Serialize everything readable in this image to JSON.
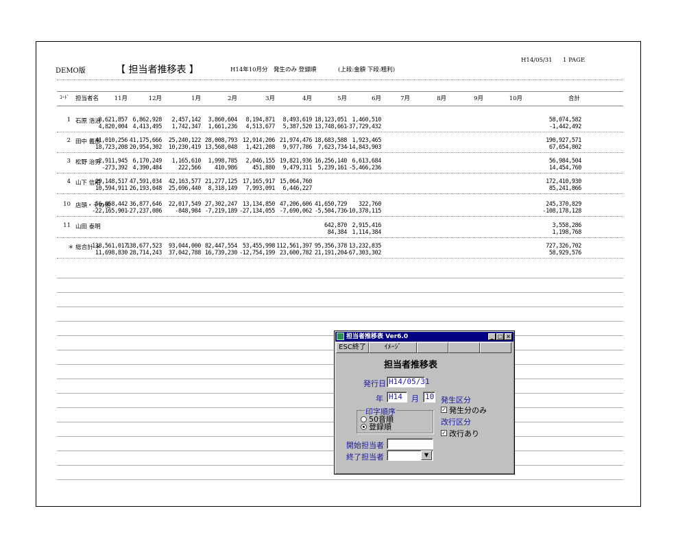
{
  "report": {
    "label": "DEMO版",
    "title": "【 担当者推移表 】",
    "condition": "H14年10月分　発生のみ 登録順",
    "legend": "(上段:金額 下段:粗利)",
    "date": "H14/05/31",
    "page": "1 PAGE"
  },
  "columns": {
    "code": "ｺｰﾄﾞ",
    "name": "担当者名",
    "months": [
      "11月",
      "12月",
      "1月",
      "2月",
      "3月",
      "4月",
      "5月",
      "6月",
      "7月",
      "8月",
      "9月",
      "10月"
    ],
    "total": "合計"
  },
  "rows": [
    {
      "code": "1",
      "name": "石原 浩治",
      "amount": [
        "8,621,857",
        "6,862,928",
        "2,457,142",
        "3,860,604",
        "8,194,871",
        "8,493,619",
        "18,123,051",
        "1,460,510"
      ],
      "amount_total": "58,074,582",
      "profit": [
        "4,820,004",
        "4,413,495",
        "1,742,347",
        "1,661,236",
        "4,513,677",
        "5,387,520",
        "13,748,661",
        "-37,729,432"
      ],
      "profit_total": "-1,442,492"
    },
    {
      "code": "2",
      "name": "田中 義彦",
      "amount": [
        "41,010,256",
        "41,175,666",
        "25,240,122",
        "28,008,793",
        "12,914,206",
        "21,974,476",
        "18,683,588",
        "1,923,465"
      ],
      "amount_total": "190,927,571",
      "profit": [
        "18,723,208",
        "20,954,302",
        "10,230,419",
        "13,568,048",
        "1,421,208",
        "9,977,786",
        "7,623,734",
        "-14,843,903"
      ],
      "profit_total": "67,654,802"
    },
    {
      "code": "3",
      "name": "松野 治男",
      "amount": [
        "2,911,945",
        "6,170,249",
        "1,165,610",
        "1,998,785",
        "2,046,155",
        "19,821,936",
        "16,256,140",
        "6,613,684"
      ],
      "amount_total": "56,984,504",
      "profit": [
        "-273,392",
        "4,390,484",
        "222,566",
        "410,986",
        "451,880",
        "9,479,311",
        "5,239,161",
        "-5,466,236"
      ],
      "profit_total": "14,454,760"
    },
    {
      "code": "4",
      "name": "山下 信昭",
      "amount": [
        "29,148,517",
        "47,591,034",
        "42,163,577",
        "21,277,125",
        "17,165,917",
        "15,064,760",
        "",
        ""
      ],
      "amount_total": "172,410,930",
      "profit": [
        "10,594,911",
        "26,193,048",
        "25,696,440",
        "8,318,149",
        "7,993,091",
        "6,446,227",
        "",
        ""
      ],
      "profit_total": "85,241,866"
    },
    {
      "code": "10",
      "name": "店頭・その他",
      "amount": [
        "56,858,442",
        "36,877,646",
        "22,017,549",
        "27,302,247",
        "13,134,850",
        "47,206,606",
        "41,650,729",
        "322,760"
      ],
      "amount_total": "245,370,829",
      "profit": [
        "-22,165,901",
        "-27,237,086",
        "-848,984",
        "-7,219,189",
        "-27,134,055",
        "-7,690,062",
        "-5,504,736",
        "-10,378,115"
      ],
      "profit_total": "-108,178,128"
    },
    {
      "code": "11",
      "name": "山田 泰明",
      "amount": [
        "",
        "",
        "",
        "",
        "",
        "",
        "642,870",
        "2,915,416"
      ],
      "amount_total": "3,558,286",
      "profit": [
        "",
        "",
        "",
        "",
        "",
        "",
        "84,384",
        "1,114,384"
      ],
      "profit_total": "1,198,768"
    },
    {
      "code": "",
      "name": "＊ 総合計 ＊",
      "amount": [
        "138,561,017",
        "138,677,523",
        "93,044,000",
        "82,447,554",
        "53,455,998",
        "112,561,397",
        "95,356,378",
        "13,232,835"
      ],
      "amount_total": "727,326,702",
      "profit": [
        "11,698,830",
        "28,714,243",
        "37,042,788",
        "16,739,230",
        "-12,754,199",
        "23,600,782",
        "21,191,204",
        "-67,303,302"
      ],
      "profit_total": "58,929,576"
    }
  ],
  "dialog": {
    "window_title": "担当者推移表 Ver6.0",
    "esc_button": "ESC終了",
    "image_button": "ｲﾒｰｼﾞ",
    "heading": "担当者推移表",
    "issue_date_label": "発行日",
    "issue_date_value": "H14/05/31",
    "year_label": "年",
    "year_value": "H14",
    "month_label": "月",
    "month_value": "10",
    "print_order_label": "印字順序",
    "order_option_1": "50音順",
    "order_option_2": "登録順",
    "occur_label": "発生区分",
    "occur_option": "発生分のみ",
    "pagebreak_label": "改行区分",
    "pagebreak_option": "改行あり",
    "start_rep_label": "開始担当者",
    "end_rep_label": "終了担当者",
    "start_rep_value": "",
    "end_rep_value": ""
  }
}
